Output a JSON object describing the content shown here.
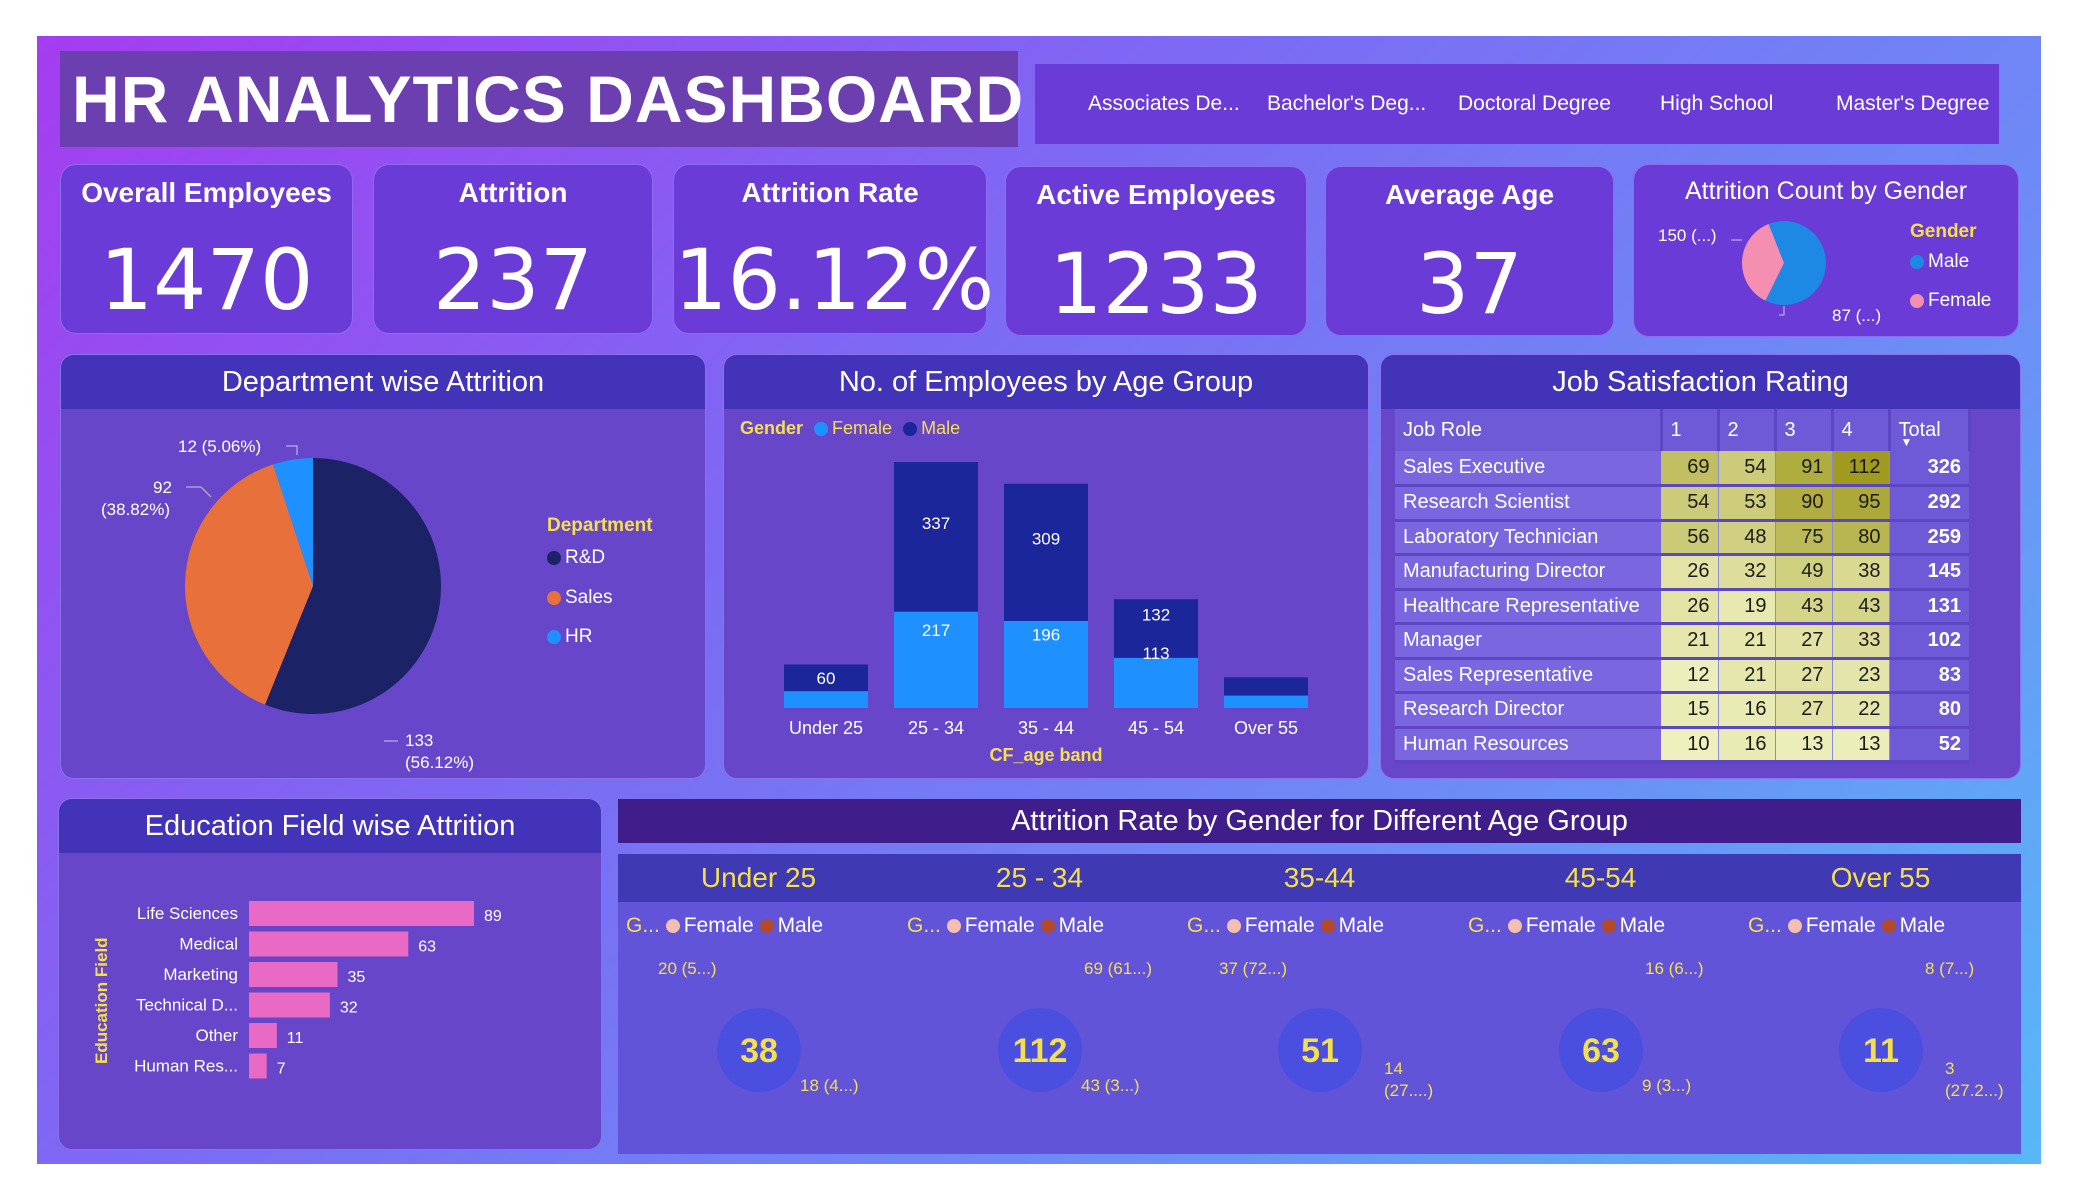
{
  "title": "HR ANALYTICS DASHBOARD",
  "slicer": [
    "Associates De...",
    "Bachelor's Deg...",
    "Doctoral Degree",
    "High School",
    "Master's Degree"
  ],
  "kpis": [
    {
      "label": "Overall Employees",
      "value": "1470"
    },
    {
      "label": "Attrition",
      "value": "237"
    },
    {
      "label": "Attrition Rate",
      "value": "16.12%"
    },
    {
      "label": "Active Employees",
      "value": "1233"
    },
    {
      "label": "Average Age",
      "value": "37"
    }
  ],
  "colors": {
    "male": "#1e88e5",
    "female": "#f48fb1",
    "rd": "#1b2266",
    "sales": "#e8703a",
    "hr": "#1e90ff",
    "bar_female": "#1e90ff",
    "bar_male": "#1a2699",
    "edu_bar": "#e86ac4",
    "donut_male": "#b34a2a",
    "donut_female": "#f4bfae",
    "accent_yellow": "#f5e04a"
  },
  "gender_attrition": {
    "title": "Attrition Count by Gender",
    "legend_title": "Gender",
    "legend": [
      "Male",
      "Female"
    ],
    "labels": {
      "male": "150 (...)",
      "female": "87 (...)"
    }
  },
  "department_attrition": {
    "title": "Department wise Attrition",
    "legend_title": "Department",
    "legend": [
      "R&D",
      "Sales",
      "HR"
    ],
    "labels": {
      "rd_value": "133",
      "rd_pct": "(56.12%)",
      "sales_value": "92",
      "sales_pct": "(38.82%)",
      "hr": "12 (5.06%)"
    }
  },
  "age_group": {
    "title": "No. of Employees by Age Group",
    "legend_title": "Gender",
    "legend": [
      "Female",
      "Male"
    ],
    "xlabel": "CF_age band"
  },
  "job_satisfaction": {
    "title": "Job Satisfaction Rating",
    "columns": [
      "Job Role",
      "1",
      "2",
      "3",
      "4",
      "Total"
    ],
    "rows": [
      {
        "role": "Sales Executive",
        "r1": "69",
        "r2": "54",
        "r3": "91",
        "r4": "112",
        "total": "326"
      },
      {
        "role": "Research Scientist",
        "r1": "54",
        "r2": "53",
        "r3": "90",
        "r4": "95",
        "total": "292"
      },
      {
        "role": "Laboratory Technician",
        "r1": "56",
        "r2": "48",
        "r3": "75",
        "r4": "80",
        "total": "259"
      },
      {
        "role": "Manufacturing Director",
        "r1": "26",
        "r2": "32",
        "r3": "49",
        "r4": "38",
        "total": "145"
      },
      {
        "role": "Healthcare Representative",
        "r1": "26",
        "r2": "19",
        "r3": "43",
        "r4": "43",
        "total": "131"
      },
      {
        "role": "Manager",
        "r1": "21",
        "r2": "21",
        "r3": "27",
        "r4": "33",
        "total": "102"
      },
      {
        "role": "Sales Representative",
        "r1": "12",
        "r2": "21",
        "r3": "27",
        "r4": "23",
        "total": "83"
      },
      {
        "role": "Research Director",
        "r1": "15",
        "r2": "16",
        "r3": "27",
        "r4": "22",
        "total": "80"
      },
      {
        "role": "Human Resources",
        "r1": "10",
        "r2": "16",
        "r3": "13",
        "r4": "13",
        "total": "52"
      }
    ]
  },
  "education_field": {
    "title": "Education Field wise Attrition",
    "ylabel": "Education Field"
  },
  "gender_age": {
    "title": "Attrition Rate by Gender for Different Age Group",
    "legend_title": "G...",
    "legend": [
      "Female",
      "Male"
    ]
  },
  "chart_data": [
    {
      "type": "pie",
      "title": "Attrition Count by Gender",
      "categories": [
        "Male",
        "Female"
      ],
      "values": [
        150,
        87
      ],
      "legend_position": "right"
    },
    {
      "type": "pie",
      "title": "Department wise Attrition",
      "categories": [
        "R&D",
        "Sales",
        "HR"
      ],
      "values": [
        133,
        92,
        12
      ],
      "percents": [
        56.12,
        38.82,
        5.06
      ],
      "legend_position": "right"
    },
    {
      "type": "bar",
      "stacked": true,
      "title": "No. of Employees by Age Group",
      "xlabel": "CF_age band",
      "categories": [
        "Under 25",
        "25 - 34",
        "35 - 44",
        "45 - 54",
        "Over 55"
      ],
      "series": [
        {
          "name": "Female",
          "values": [
            38,
            217,
            196,
            113,
            28
          ]
        },
        {
          "name": "Male",
          "values": [
            60,
            337,
            309,
            132,
            41
          ]
        }
      ],
      "labels_shown": [
        [
          null,
          "217",
          "196",
          "113",
          null
        ],
        [
          "60",
          "337",
          "309",
          "132",
          null
        ]
      ],
      "legend_position": "top-left"
    },
    {
      "type": "table",
      "title": "Job Satisfaction Rating",
      "columns": [
        "Job Role",
        "1",
        "2",
        "3",
        "4",
        "Total"
      ]
    },
    {
      "type": "bar",
      "orientation": "horizontal",
      "title": "Education Field wise Attrition",
      "ylabel": "Education Field",
      "categories": [
        "Life Sciences",
        "Medical",
        "Marketing",
        "Technical D...",
        "Other",
        "Human Res..."
      ],
      "values": [
        89,
        63,
        35,
        32,
        11,
        7
      ]
    },
    {
      "type": "pie",
      "donut": true,
      "title": "Attrition Rate by Gender for Different Age Group",
      "groups": [
        {
          "name": "Under 25",
          "total": "38",
          "male": 20,
          "female": 18,
          "male_label": "20 (5...)",
          "female_label": "18 (4...)"
        },
        {
          "name": "25 - 34",
          "total": "112",
          "male": 69,
          "female": 43,
          "male_label": "69 (61...)",
          "female_label": "43 (3...)"
        },
        {
          "name": "35-44",
          "total": "51",
          "male": 37,
          "female": 14,
          "male_label": "37 (72...)",
          "female_label": "14",
          "female_label2": "(27....)"
        },
        {
          "name": "45-54",
          "total": "63",
          "male": 16,
          "female": 9,
          "male_label": "16 (6...)",
          "female_label": "9 (3...)"
        },
        {
          "name": "Over 55",
          "total": "11",
          "male": 8,
          "female": 3,
          "male_label": "8 (7...)",
          "female_label": "3",
          "female_label2": "(27.2...)"
        }
      ]
    }
  ]
}
